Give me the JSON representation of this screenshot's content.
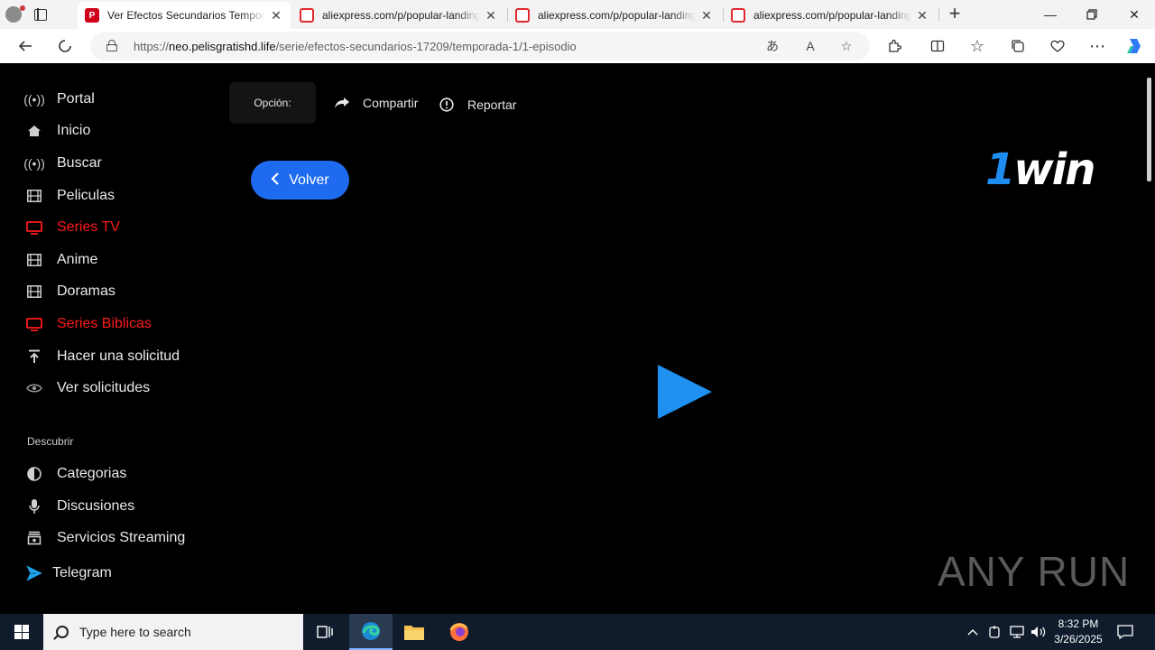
{
  "browser": {
    "tabs": [
      {
        "title": "Ver Efectos Secundarios Temporada",
        "icon": "p-logo-icon",
        "active": true
      },
      {
        "title": "aliexpress.com/p/popular-landing",
        "icon": "aliexpress-icon",
        "active": false
      },
      {
        "title": "aliexpress.com/p/popular-landing",
        "icon": "aliexpress-icon",
        "active": false
      },
      {
        "title": "aliexpress.com/p/popular-landing",
        "icon": "aliexpress-icon",
        "active": false
      }
    ],
    "url_scheme": "https://",
    "url_host": "neo.pelisgratishd.life",
    "url_path": "/serie/efectos-secundarios-17209/temporada-1/1-episodio"
  },
  "sidebar": {
    "items": [
      {
        "label": "Portal",
        "icon": "broadcast-icon",
        "highlight": false
      },
      {
        "label": "Inicio",
        "icon": "home-icon",
        "highlight": false
      },
      {
        "label": "Buscar",
        "icon": "broadcast-icon",
        "highlight": false
      },
      {
        "label": "Peliculas",
        "icon": "film-icon",
        "highlight": false
      },
      {
        "label": "Series TV",
        "icon": "tv-icon",
        "highlight": true
      },
      {
        "label": "Anime",
        "icon": "film-icon",
        "highlight": false
      },
      {
        "label": "Doramas",
        "icon": "film-icon",
        "highlight": false
      },
      {
        "label": "Series Biblicas",
        "icon": "tv-icon",
        "highlight": true
      },
      {
        "label": "Hacer una solicitud",
        "icon": "upload-icon",
        "highlight": false
      },
      {
        "label": "Ver solicitudes",
        "icon": "eye-icon",
        "highlight": false
      }
    ],
    "discover_label": "Descubrir",
    "discover_items": [
      {
        "label": "Categorias",
        "icon": "half-circle-icon"
      },
      {
        "label": "Discusiones",
        "icon": "microphone-icon"
      },
      {
        "label": "Servicios Streaming",
        "icon": "stack-icon"
      },
      {
        "label": "Telegram",
        "icon": "telegram-icon"
      }
    ]
  },
  "player": {
    "option_label": "Opción:",
    "share_label": "Compartir",
    "report_label": "Reportar",
    "back_label": "Volver",
    "brand_one": "1",
    "brand_win": "win"
  },
  "watermark": "ANY RUN",
  "taskbar": {
    "search_placeholder": "Type here to search",
    "time": "8:32 PM",
    "date": "3/26/2025"
  },
  "colors": {
    "accent_red": "#ff1a1a",
    "button_blue": "#1e6bf0",
    "play_blue": "#1e90f0"
  }
}
